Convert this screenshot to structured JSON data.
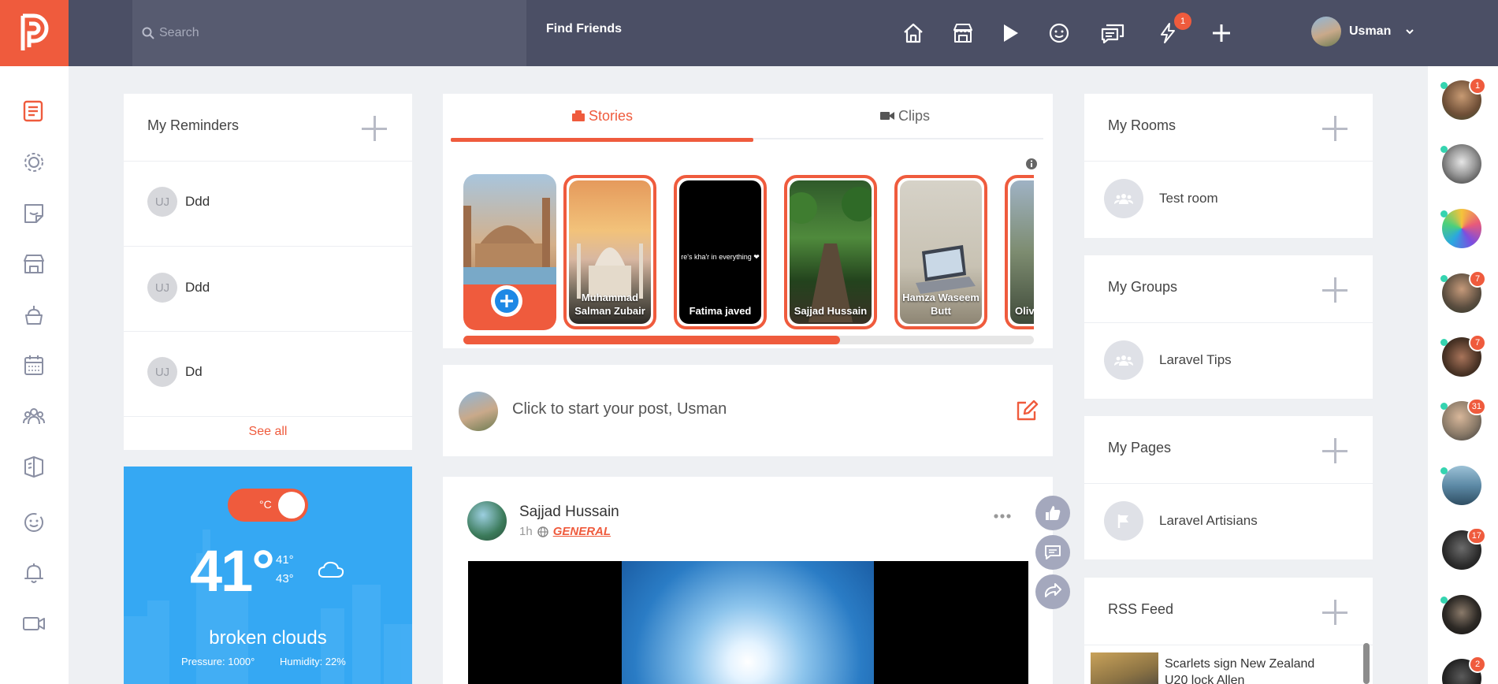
{
  "header": {
    "search_placeholder": "Search",
    "find_friends": "Find Friends",
    "notification_count": "1",
    "user_name": "Usman"
  },
  "reminders": {
    "title": "My Reminders",
    "items": [
      {
        "initials": "UJ",
        "text": "Ddd"
      },
      {
        "initials": "UJ",
        "text": "Ddd"
      },
      {
        "initials": "UJ",
        "text": "Dd"
      }
    ],
    "see_all": "See all"
  },
  "weather": {
    "unit": "°C",
    "temp": "41°",
    "high": "41°",
    "low": "43°",
    "description": "broken clouds",
    "pressure": "Pressure: 1000°",
    "humidity": "Humidity: 22%"
  },
  "stories": {
    "tab_stories": "Stories",
    "tab_clips": "Clips",
    "items": [
      {
        "name": "Muhammad Salman Zubair"
      },
      {
        "name": "Fatima javed",
        "caption": "re's kha'r in everything ❤"
      },
      {
        "name": "Sajjad Hussain"
      },
      {
        "name": "Hamza Waseem Butt"
      },
      {
        "name": "Oliv"
      }
    ],
    "progress": 0.66
  },
  "composer": {
    "placeholder": "Click to start your post, Usman"
  },
  "post": {
    "author": "Sajjad Hussain",
    "time": "1h",
    "category": "GENERAL"
  },
  "rooms": {
    "title": "My Rooms",
    "item": "Test room"
  },
  "groups": {
    "title": "My Groups",
    "item": "Laravel Tips"
  },
  "pages": {
    "title": "My Pages",
    "item": "Laravel Artisians"
  },
  "rss": {
    "title": "RSS Feed",
    "item": "Scarlets sign New Zealand U20 lock Allen"
  },
  "contacts": [
    {
      "badge": "1"
    },
    {
      "badge": ""
    },
    {
      "badge": ""
    },
    {
      "badge": "7"
    },
    {
      "badge": "7"
    },
    {
      "badge": "31"
    },
    {
      "badge": ""
    },
    {
      "badge": "17"
    },
    {
      "badge": ""
    },
    {
      "badge": "2"
    }
  ],
  "colors": {
    "accent": "#ef5b3d",
    "header": "#4b4f65",
    "weather": "#35a8f3"
  }
}
